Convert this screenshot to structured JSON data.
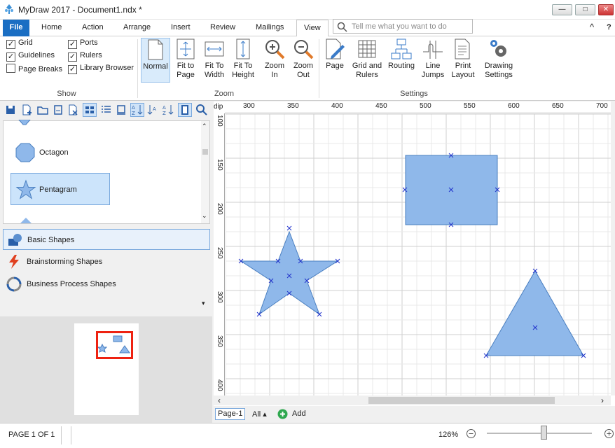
{
  "window": {
    "title": "MyDraw 2017 - Document1.ndx *",
    "min": "—",
    "max": "□",
    "close": "✕"
  },
  "menu": {
    "file": "File",
    "home": "Home",
    "action": "Action",
    "arrange": "Arrange",
    "insert": "Insert",
    "review": "Review",
    "mailings": "Mailings",
    "view": "View",
    "tell_placeholder": "Tell me what you want to do",
    "collapse": "^",
    "help": "?"
  },
  "ribbon": {
    "show": {
      "label": "Show",
      "grid": "Grid",
      "guidelines": "Guidelines",
      "page_breaks": "Page Breaks",
      "ports": "Ports",
      "rulers": "Rulers",
      "library_browser": "Library Browser"
    },
    "zoom": {
      "label": "Zoom",
      "normal": "Normal",
      "fit_page_1": "Fit to",
      "fit_page_2": "Page",
      "fit_width_1": "Fit To",
      "fit_width_2": "Width",
      "fit_height_1": "Fit To",
      "fit_height_2": "Height",
      "zoom_in_1": "Zoom",
      "zoom_in_2": "In",
      "zoom_out_1": "Zoom",
      "zoom_out_2": "Out"
    },
    "settings": {
      "label": "Settings",
      "page": "Page",
      "grid_rulers_1": "Grid and",
      "grid_rulers_2": "Rulers",
      "routing": "Routing",
      "line_jumps_1": "Line",
      "line_jumps_2": "Jumps",
      "print_layout_1": "Print",
      "print_layout_2": "Layout",
      "drawing_1": "Drawing",
      "drawing_2": "Settings"
    }
  },
  "shapes": {
    "octagon": "Octagon",
    "pentagram": "Pentagram"
  },
  "libraries": {
    "basic": "Basic Shapes",
    "brainstorming": "Brainstorming Shapes",
    "business": "Business Process Shapes"
  },
  "ruler": {
    "unit": "dip",
    "h_ticks": [
      "300",
      "350",
      "400",
      "450",
      "500",
      "550",
      "600",
      "650",
      "700"
    ],
    "v_ticks": [
      "100",
      "150",
      "200",
      "250",
      "300",
      "350",
      "400"
    ]
  },
  "pagebar": {
    "page": "Page-1",
    "all": "All ▴",
    "add": "Add"
  },
  "status": {
    "page": "PAGE 1 OF 1",
    "zoom": "126%"
  },
  "colors": {
    "accent": "#1a6ec3",
    "shape_fill": "#8fb8ea",
    "shape_stroke": "#4a7fc0",
    "selection": "#d7e8fa"
  }
}
